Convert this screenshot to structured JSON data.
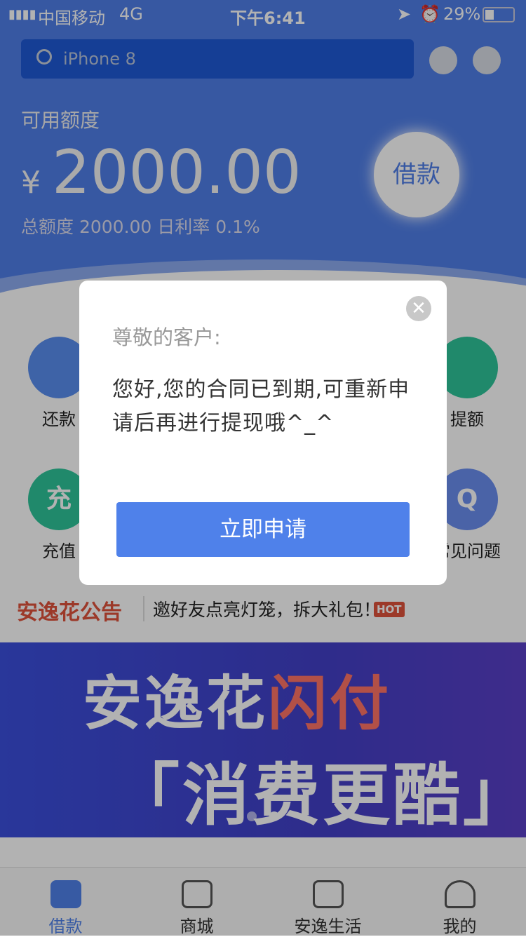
{
  "status": {
    "carrier": "中国移动",
    "network": "4G",
    "time": "下午6:41",
    "battery": "29%",
    "battery_level": 0.29
  },
  "search": {
    "placeholder": "iPhone 8"
  },
  "account": {
    "available_label": "可用额度",
    "currency": "¥",
    "amount": "2000.00",
    "summary": "总额度 2000.00  日利率 0.1%",
    "borrow_button": "借款"
  },
  "grid": [
    {
      "label": "还款",
      "color": "#5a8ff0"
    },
    {
      "label": "提额",
      "color": "#2ec49a"
    },
    {
      "label": "充值",
      "color": "#2ec49a",
      "glyph": "充"
    },
    {
      "label": "常见问题",
      "color": "#6a8ff0",
      "glyph": "Q"
    }
  ],
  "notice": {
    "brand": "安逸花公告",
    "text": "邀好友点亮灯笼，拆大礼包！",
    "badge": "HOT"
  },
  "banner": {
    "line1a": "安逸花",
    "line1b": "闪付",
    "line2": "「消费更酷」"
  },
  "tabs": [
    {
      "label": "借款",
      "active": true
    },
    {
      "label": "商城"
    },
    {
      "label": "安逸生活"
    },
    {
      "label": "我的"
    }
  ],
  "modal": {
    "title": "尊敬的客户:",
    "body": "您好,您的合同已到期,可重新申请后再进行提现哦^_^",
    "button": "立即申请"
  },
  "colors": {
    "primary": "#4f81ea",
    "brand_red": "#e0523c"
  }
}
